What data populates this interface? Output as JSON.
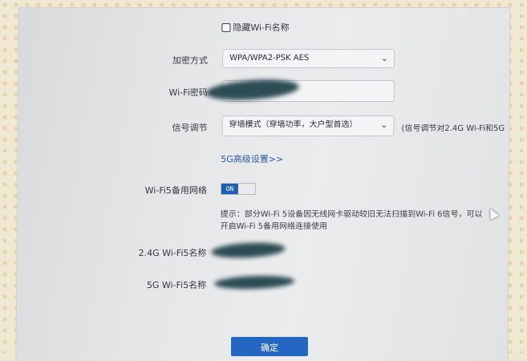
{
  "hide_ssid": {
    "label": "隐藏Wi-Fi名称",
    "checked": false
  },
  "encryption": {
    "label": "加密方式",
    "value": "WPA/WPA2-PSK AES"
  },
  "password": {
    "label": "Wi-Fi密码"
  },
  "signal": {
    "label": "信号调节",
    "value": "穿墙模式（穿墙功率，大户型首选）",
    "note": "(信号调节对2.4G Wi-Fi和5G"
  },
  "advanced_link": "5G高级设置>>",
  "wifi5_backup": {
    "label": "Wi-Fi5备用网络",
    "toggle": "ON"
  },
  "hint_line1": "提示：部分Wi-Fi 5设备因无线网卡驱动较旧无法扫描到Wi-Fi 6信号，可以",
  "hint_line2": "开启Wi-Fi 5备用网络连接使用",
  "wifi5_24g_name_label": "2.4G Wi-Fi5名称",
  "wifi5_5g_name_label": "5G Wi-Fi5名称",
  "submit_label": "确定",
  "colors": {
    "accent": "#2467c2",
    "link": "#2a5aa8",
    "redaction": "#1d3f48"
  }
}
